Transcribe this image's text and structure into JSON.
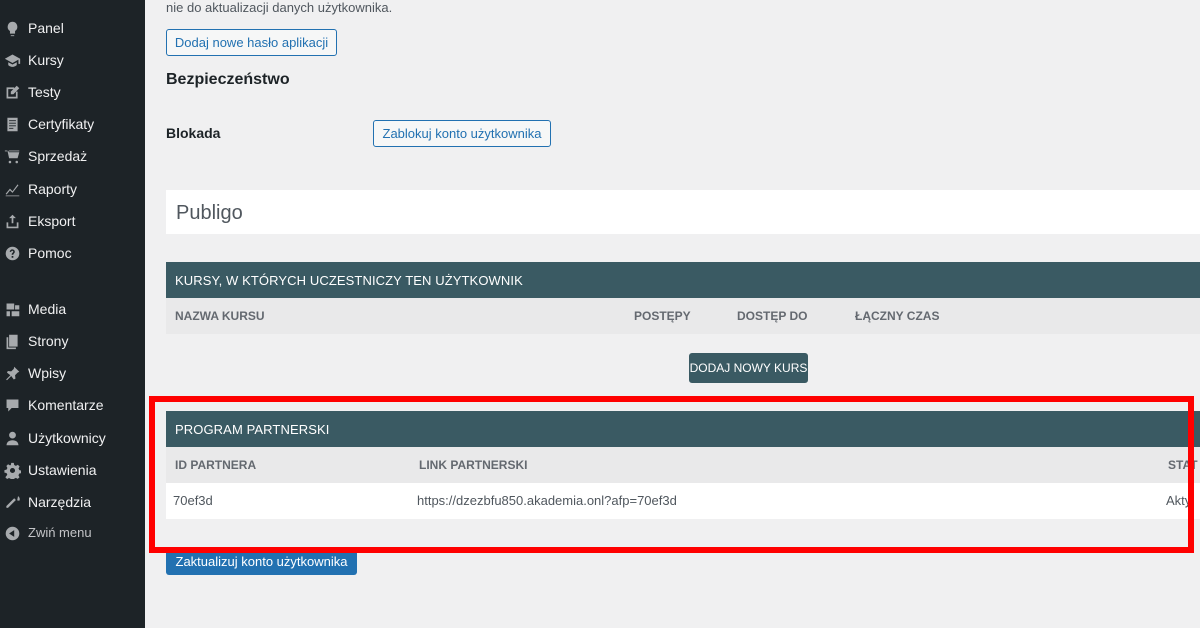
{
  "sidebar": {
    "items": [
      {
        "label": "Panel",
        "icon": "dashboard-icon"
      },
      {
        "label": "Kursy",
        "icon": "graduation-cap-icon"
      },
      {
        "label": "Testy",
        "icon": "edit-icon"
      },
      {
        "label": "Certyfikaty",
        "icon": "certificate-icon"
      },
      {
        "label": "Sprzedaż",
        "icon": "cart-icon"
      },
      {
        "label": "Raporty",
        "icon": "chart-icon"
      },
      {
        "label": "Eksport",
        "icon": "export-icon"
      },
      {
        "label": "Pomoc",
        "icon": "help-icon"
      },
      {
        "label": "Media",
        "icon": "media-icon"
      },
      {
        "label": "Strony",
        "icon": "pages-icon"
      },
      {
        "label": "Wpisy",
        "icon": "pin-icon"
      },
      {
        "label": "Komentarze",
        "icon": "comments-icon"
      },
      {
        "label": "Użytkownicy",
        "icon": "users-icon"
      },
      {
        "label": "Ustawienia",
        "icon": "settings-icon"
      },
      {
        "label": "Narzędzia",
        "icon": "tools-icon"
      },
      {
        "label": "Zwiń menu",
        "icon": "collapse-icon"
      }
    ]
  },
  "main": {
    "top_text": "nie do aktualizacji danych użytkownika.",
    "add_app_password_label": "Dodaj nowe hasło aplikacji",
    "security_heading": "Bezpieczeństwo",
    "block_label": "Blokada",
    "block_button_label": "Zablokuj konto użytkownika",
    "publigo_title": "Publigo",
    "courses": {
      "title": "KURSY, W KTÓRYCH UCZESTNICZY TEN UŻYTKOWNIK",
      "columns": [
        "NAZWA KURSU",
        "POSTĘPY",
        "DOSTĘP DO",
        "ŁĄCZNY CZAS"
      ],
      "add_button_label": "DODAJ NOWY KURS"
    },
    "affiliate": {
      "title": "PROGRAM PARTNERSKI",
      "columns": [
        "ID PARTNERA",
        "LINK PARTNERSKI",
        "STAT"
      ],
      "row": {
        "id": "70ef3d",
        "link": "https://dzezbfu850.akademia.onl?afp=70ef3d",
        "status": "Akty"
      }
    },
    "update_button_label": "Zaktualizuj konto użytkownika"
  },
  "colors": {
    "sidebar_bg": "#1d2327",
    "panel_header": "#3a5a63",
    "primary": "#2271b1",
    "highlight": "#ff0000"
  }
}
